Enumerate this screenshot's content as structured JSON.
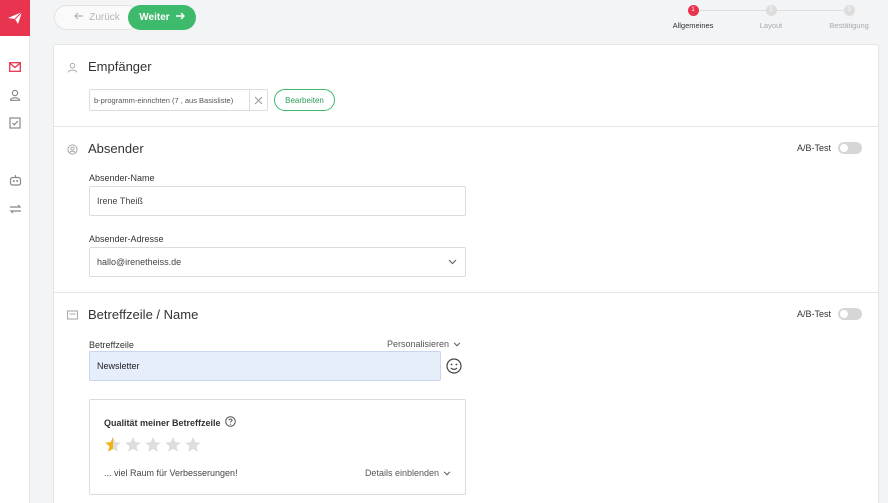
{
  "nav": {
    "back_label": "Zurück",
    "next_label": "Weiter",
    "steps": [
      {
        "number": "1",
        "label": "Allgemeines",
        "active": true
      },
      {
        "number": "2",
        "label": "Layout",
        "active": false
      },
      {
        "number": "3",
        "label": "Bestätigung",
        "active": false
      }
    ]
  },
  "recipients": {
    "title": "Empfänger",
    "chip_text": "b-programm-einrichten (7 , aus Basisliste)",
    "edit_label": "Bearbeiten"
  },
  "sender": {
    "title": "Absender",
    "ab_test_label": "A/B-Test",
    "name_label": "Absender-Name",
    "name_value": "Irene Theiß",
    "address_label": "Absender-Adresse",
    "address_value": "hallo@irenetheiss.de"
  },
  "subject": {
    "title": "Betreffzeile / Name",
    "ab_test_label": "A/B-Test",
    "field_label": "Betreffzeile",
    "personalize_label": "Personalisieren",
    "value": "Newsletter",
    "quality": {
      "title": "Qualität meiner Betreffzeile",
      "rating": 0.5,
      "max_rating": 5,
      "message": "... viel Raum für Verbesserungen!",
      "details_label": "Details einblenden"
    }
  },
  "colors": {
    "brand": "#e8344e",
    "accent_green": "#3dba6b",
    "star_fill": "#f2b21a",
    "star_empty": "#dedede",
    "subject_input_bg": "#e6eefb"
  }
}
